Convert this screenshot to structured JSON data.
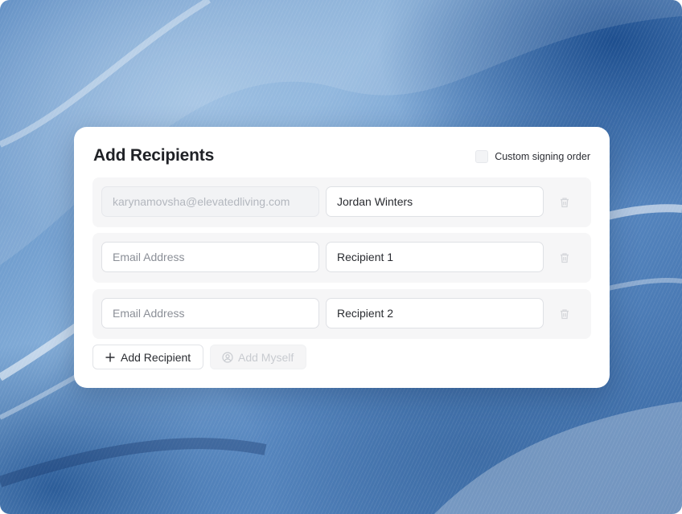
{
  "card": {
    "title": "Add Recipients",
    "signing_order_label": "Custom signing order",
    "signing_order_checked": false
  },
  "recipients": [
    {
      "email_value": "karynamovsha@elevatedliving.com",
      "email_placeholder": "Email Address",
      "email_disabled": true,
      "name_value": "Jordan Winters"
    },
    {
      "email_value": "",
      "email_placeholder": "Email Address",
      "email_disabled": false,
      "name_value": "Recipient 1"
    },
    {
      "email_value": "",
      "email_placeholder": "Email Address",
      "email_disabled": false,
      "name_value": "Recipient 2"
    }
  ],
  "actions": {
    "add_recipient_label": "Add Recipient",
    "add_myself_label": "Add Myself"
  },
  "icons": {
    "delete": "trash-icon",
    "add": "plus-icon",
    "myself": "user-circle-icon"
  },
  "colors": {
    "card_bg": "#ffffff",
    "row_bg": "#f6f6f7",
    "title_text": "#1f2126",
    "background_accent": "#3a6aa6"
  }
}
